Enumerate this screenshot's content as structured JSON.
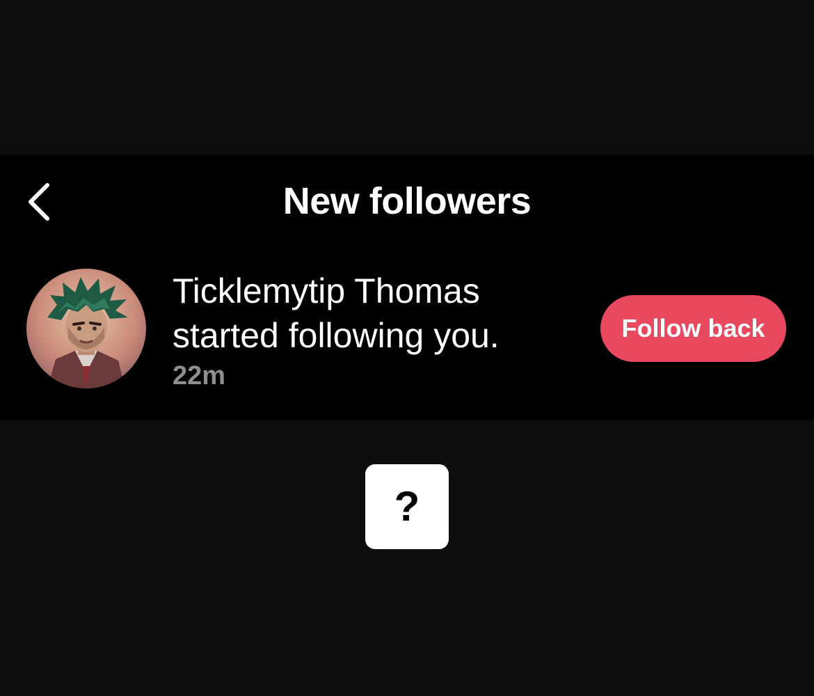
{
  "header": {
    "title": "New followers",
    "back_icon": "chevron-left-icon"
  },
  "notification": {
    "username": "Ticklemytip Thomas",
    "action": "started following you.",
    "time": "22m",
    "avatar_icon": "user-avatar",
    "button_label": "Follow back"
  },
  "overlay": {
    "symbol": "?"
  },
  "colors": {
    "background": "#0c0c0c",
    "panel": "#000000",
    "accent": "#e8495f",
    "muted_text": "#8e8e8e"
  }
}
